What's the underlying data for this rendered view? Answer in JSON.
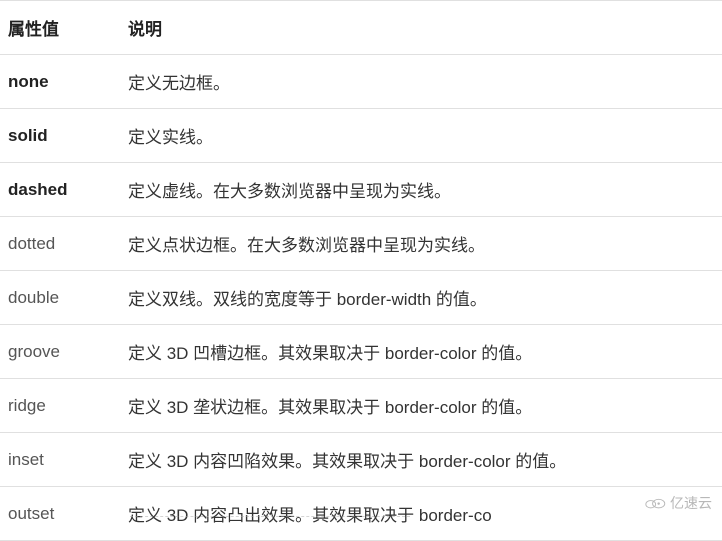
{
  "headers": {
    "value": "属性值",
    "desc": "说明"
  },
  "rows": [
    {
      "value": "none",
      "bold": true,
      "desc": "定义无边框。"
    },
    {
      "value": "solid",
      "bold": true,
      "desc": "定义实线。"
    },
    {
      "value": "dashed",
      "bold": true,
      "desc": "定义虚线。在大多数浏览器中呈现为实线。"
    },
    {
      "value": "dotted",
      "bold": false,
      "desc": "定义点状边框。在大多数浏览器中呈现为实线。"
    },
    {
      "value": "double",
      "bold": false,
      "desc": "定义双线。双线的宽度等于 border-width 的值。"
    },
    {
      "value": "groove",
      "bold": false,
      "desc": "定义 3D 凹槽边框。其效果取决于 border-color 的值。"
    },
    {
      "value": "ridge",
      "bold": false,
      "desc": "定义 3D 垄状边框。其效果取决于 border-color 的值。"
    },
    {
      "value": "inset",
      "bold": false,
      "desc": "定义 3D 内容凹陷效果。其效果取决于 border-color 的值。"
    },
    {
      "value": "outset",
      "bold": false,
      "desc": "定义 3D 内容凸出效果。其效果取决于 border-co"
    }
  ],
  "watermark": "亿速云"
}
